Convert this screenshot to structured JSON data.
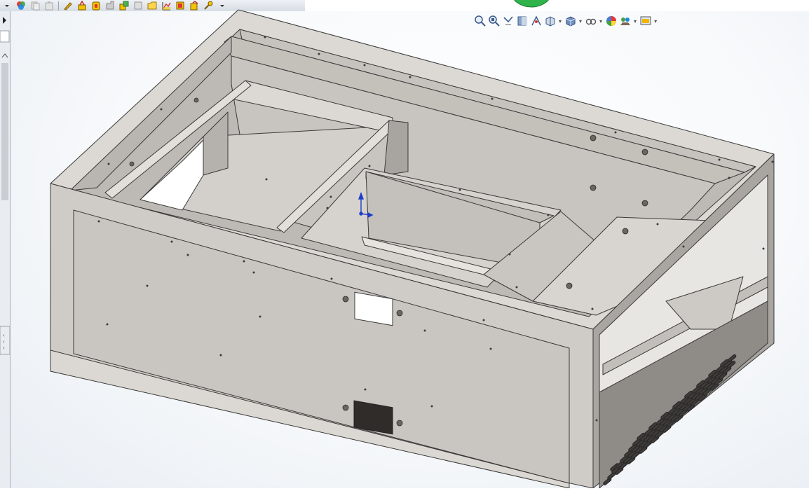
{
  "toolbar": {
    "icons": [
      "dropdown-arrow-icon",
      "appearance-icon",
      "copy-icon",
      "paste-icon",
      "sketch-icon",
      "extrude-icon",
      "revolve-icon",
      "sheet-metal-icon",
      "assembly-icon",
      "drawing-icon",
      "folder-icon",
      "chart-icon",
      "edit-part-icon",
      "check-icon",
      "tools-icon",
      "dropdown-arrow-icon"
    ]
  },
  "heads_up_toolbar": {
    "icons": [
      "zoom-to-fit-icon",
      "zoom-to-area-icon",
      "previous-view-icon",
      "section-view-icon",
      "dynamic-annotation-icon",
      "view-orientation-icon",
      "display-style-icon",
      "hide-show-items-icon",
      "edit-appearance-icon",
      "apply-scene-icon",
      "view-settings-icon"
    ]
  },
  "colors": {
    "sheet_metal": "#c9c6c1",
    "edge": "#3a3a3a",
    "triad_axis": "#1e3cc8",
    "background": "#f5f7fa"
  },
  "triad": {
    "icon": "coordinate-triad-icon"
  }
}
